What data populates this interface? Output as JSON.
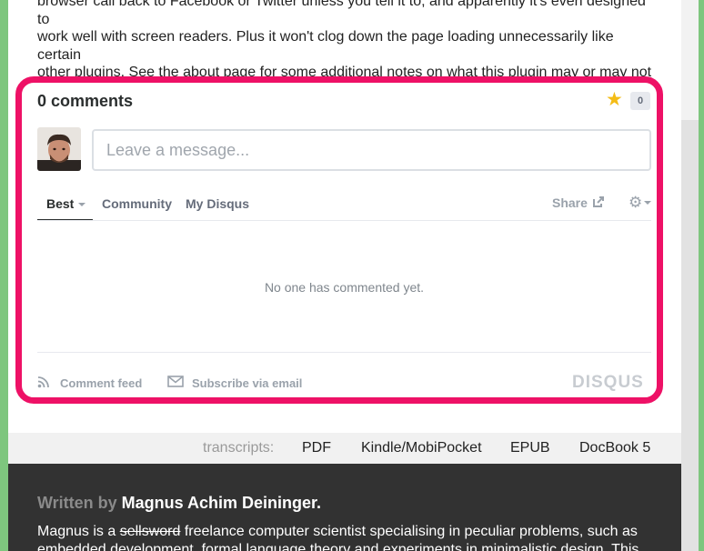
{
  "intro": {
    "line1": "browser call back to Facebook or Twitter unless you tell it to, and apparently it's even designed to",
    "line2": "work well with screen readers. Plus it won't clog down the page loading unnecessarily like certain",
    "line3_prefix": "other plugins. ",
    "about_link": "See the about page for some additional notes on what this plugin may or may not do",
    "line3_suffix": "."
  },
  "disqus": {
    "comment_count": "0 comments",
    "star_count": "0",
    "message_placeholder": "Leave a message...",
    "tabs": {
      "best": "Best",
      "community": "Community",
      "my_disqus": "My Disqus"
    },
    "share": "Share",
    "empty_text": "No one has commented yet.",
    "comment_feed": "Comment feed",
    "subscribe": "Subscribe via email",
    "brand": "DISQUS"
  },
  "transcripts": {
    "label": "transcripts:",
    "links": [
      "PDF",
      "Kindle/MobiPocket",
      "EPUB",
      "DocBook 5"
    ]
  },
  "author": {
    "written_by": "Written by ",
    "name": "Magnus Achim Deininger",
    "period": ".",
    "bio_line1_prefix": "Magnus is a ",
    "bio_struck": "sellsword",
    "bio_line1_suffix": " freelance computer scientist specialising in peculiar problems, such as",
    "bio_line2": "embedded development, formal language theory and experiments in minimalistic design. This"
  },
  "colors": {
    "highlight_frame": "#ee1166",
    "window_border": "#7ec67e",
    "author_background": "#323232",
    "star": "#f4bc16"
  }
}
